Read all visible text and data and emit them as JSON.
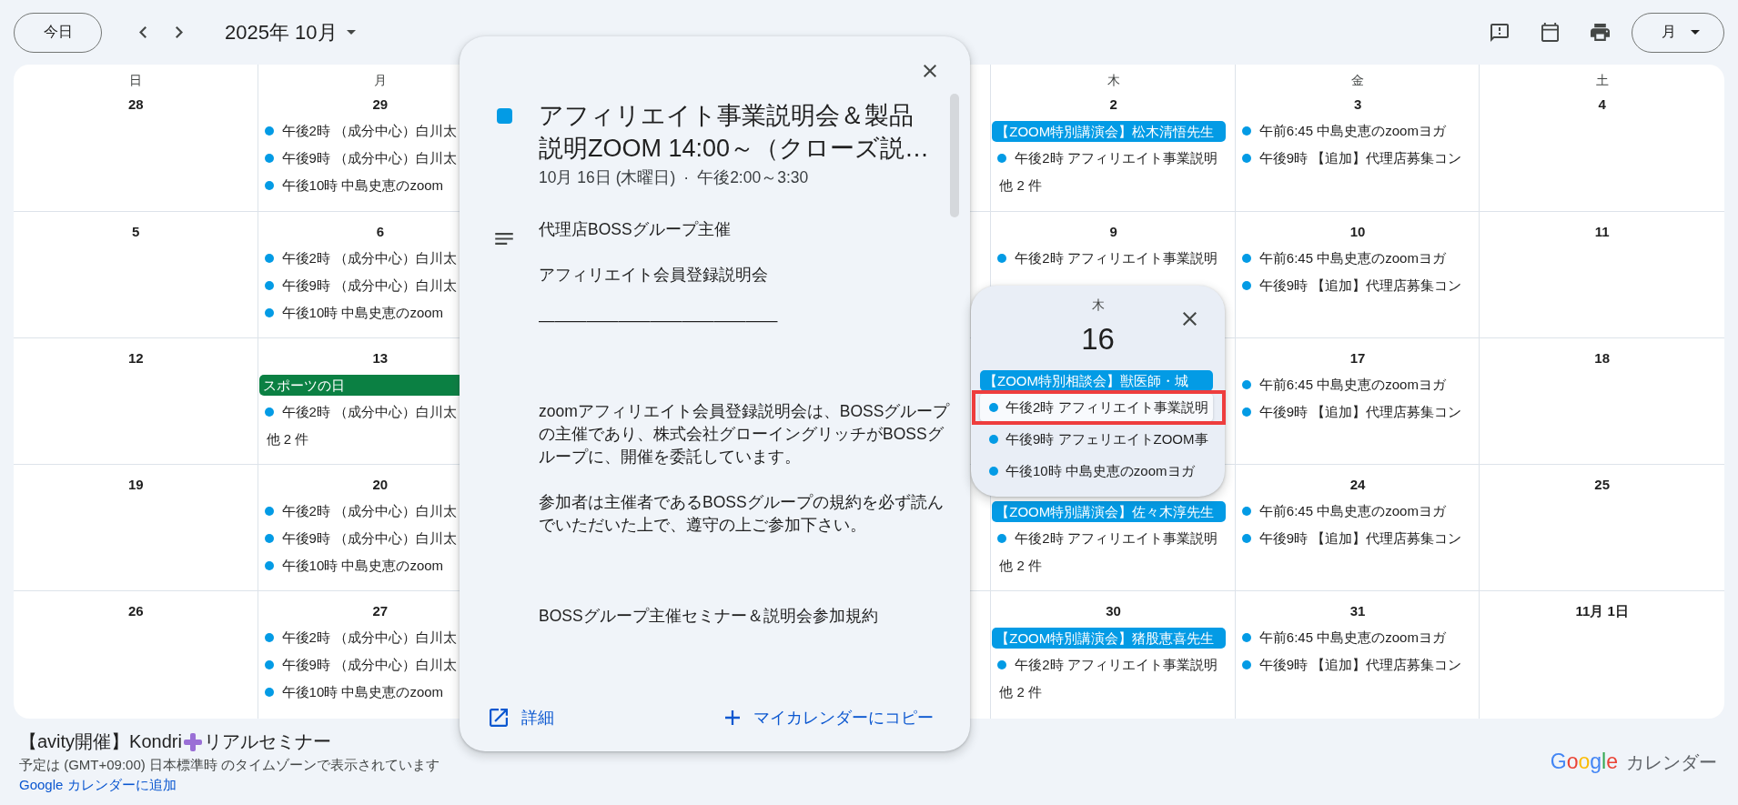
{
  "toolbar": {
    "today_button": "今日",
    "month_title": "2025年 10月",
    "view_button": "月"
  },
  "calendar": {
    "weeks": [
      {
        "days": [
          {
            "kind": "day",
            "weekday": "日",
            "date": "28"
          },
          {
            "kind": "day",
            "weekday": "月",
            "date": "29",
            "items": [
              {
                "kind": "event",
                "text": "午後2時 （成分中心）白川太"
              },
              {
                "kind": "event",
                "text": "午後9時 （成分中心）白川太"
              },
              {
                "kind": "event",
                "text": "午後10時 中島史恵のzoom"
              }
            ]
          },
          {
            "kind": "covered"
          },
          {
            "kind": "covered"
          },
          {
            "kind": "day",
            "weekday": "木",
            "date": "2",
            "items": [
              {
                "kind": "chip",
                "text": "【ZOOM特別講演会】松木清悟先生",
                "color": "#039be5"
              },
              {
                "kind": "event",
                "text": "午後2時 アフィリエイト事業説明"
              },
              {
                "kind": "more",
                "text": "他 2 件"
              }
            ]
          },
          {
            "kind": "day",
            "weekday": "金",
            "date": "3",
            "items": [
              {
                "kind": "event",
                "text": "午前6:45 中島史恵のzoomヨガ"
              },
              {
                "kind": "event",
                "text": "午後9時 【追加】代理店募集コン"
              }
            ]
          },
          {
            "kind": "day",
            "weekday": "土",
            "date": "4"
          }
        ]
      },
      {
        "days": [
          {
            "kind": "day",
            "date": "5"
          },
          {
            "kind": "day",
            "date": "6",
            "items": [
              {
                "kind": "event",
                "text": "午後2時 （成分中心）白川太"
              },
              {
                "kind": "event",
                "text": "午後9時 （成分中心）白川太"
              },
              {
                "kind": "event",
                "text": "午後10時 中島史恵のzoom"
              }
            ]
          },
          {
            "kind": "covered"
          },
          {
            "kind": "covered"
          },
          {
            "kind": "day",
            "date": "9",
            "items": [
              {
                "kind": "event",
                "text": "午後2時 アフィリエイト事業説明"
              }
            ]
          },
          {
            "kind": "day",
            "date": "10",
            "items": [
              {
                "kind": "event",
                "text": "午前6:45 中島史恵のzoomヨガ"
              },
              {
                "kind": "event",
                "text": "午後9時 【追加】代理店募集コン"
              }
            ]
          },
          {
            "kind": "day",
            "date": "11"
          }
        ]
      },
      {
        "days": [
          {
            "kind": "day",
            "date": "12"
          },
          {
            "kind": "day",
            "date": "13",
            "items": [
              {
                "kind": "chip",
                "text": "スポーツの日",
                "color": "#0b8043"
              },
              {
                "kind": "event",
                "text": "午後2時 （成分中心）白川太"
              },
              {
                "kind": "more",
                "text": "他 2 件"
              }
            ]
          },
          {
            "kind": "covered"
          },
          {
            "kind": "covered"
          },
          {
            "kind": "covered"
          },
          {
            "kind": "day",
            "date": "17",
            "items": [
              {
                "kind": "event",
                "text": "午前6:45 中島史恵のzoomヨガ"
              },
              {
                "kind": "event",
                "text": "午後9時 【追加】代理店募集コン"
              }
            ]
          },
          {
            "kind": "day",
            "date": "18"
          }
        ]
      },
      {
        "days": [
          {
            "kind": "day",
            "date": "19"
          },
          {
            "kind": "day",
            "date": "20",
            "items": [
              {
                "kind": "event",
                "text": "午後2時 （成分中心）白川太"
              },
              {
                "kind": "event",
                "text": "午後9時 （成分中心）白川太"
              },
              {
                "kind": "event",
                "text": "午後10時 中島史恵のzoom"
              }
            ]
          },
          {
            "kind": "covered"
          },
          {
            "kind": "covered"
          },
          {
            "kind": "day",
            "items": [
              {
                "kind": "chip",
                "text": "【ZOOM特別講演会】佐々木淳先生",
                "color": "#039be5"
              },
              {
                "kind": "event",
                "text": "午後2時 アフィリエイト事業説明"
              },
              {
                "kind": "more",
                "text": "他 2 件"
              }
            ]
          },
          {
            "kind": "day",
            "date": "24",
            "items": [
              {
                "kind": "event",
                "text": "午前6:45 中島史恵のzoomヨガ"
              },
              {
                "kind": "event",
                "text": "午後9時 【追加】代理店募集コン"
              }
            ]
          },
          {
            "kind": "day",
            "date": "25"
          }
        ]
      },
      {
        "days": [
          {
            "kind": "day",
            "date": "26"
          },
          {
            "kind": "day",
            "date": "27",
            "items": [
              {
                "kind": "event",
                "text": "午後2時 （成分中心）白川太"
              },
              {
                "kind": "event",
                "text": "午後9時 （成分中心）白川太"
              },
              {
                "kind": "event",
                "text": "午後10時 中島史恵のzoom"
              }
            ]
          },
          {
            "kind": "covered"
          },
          {
            "kind": "covered"
          },
          {
            "kind": "day",
            "date": "30",
            "items": [
              {
                "kind": "chip",
                "text": "【ZOOM特別講演会】猪股恵喜先生",
                "color": "#039be5"
              },
              {
                "kind": "event",
                "text": "午後2時 アフィリエイト事業説明"
              },
              {
                "kind": "more",
                "text": "他 2 件"
              }
            ]
          },
          {
            "kind": "day",
            "date": "31",
            "items": [
              {
                "kind": "event",
                "text": "午前6:45 中島史恵のzoomヨガ"
              },
              {
                "kind": "event",
                "text": "午後9時 【追加】代理店募集コン"
              }
            ]
          },
          {
            "kind": "day",
            "date": "11月 1日"
          }
        ]
      }
    ]
  },
  "event_popup": {
    "title": "アフィリエイト事業説明会＆製品説明ZOOM 14:00～（クローズ説…",
    "date": "10月 16日 (木曜日)",
    "separator": "·",
    "time": "午後2:00～3:30",
    "description": [
      "代理店BOSSグループ主催",
      "アフィリエイト会員登録説明会",
      "———————————————",
      "zoomアフィリエイト会員登録説明会は、BOSSグループの主催であり、株式会社グローイングリッチがBOSSグループに、開催を委託しています。",
      "参加者は主催者であるBOSSグループの規約を必ず読んでいただいた上で、遵守の上ご参加下さい。",
      "BOSSグループ主催セミナー＆説明会参加規約"
    ],
    "details_button": "詳細",
    "copy_button": "マイカレンダーにコピー"
  },
  "day_popup": {
    "weekday": "木",
    "date": "16",
    "items": [
      {
        "kind": "chip",
        "text": "【ZOOM特別相談会】獣医師・城",
        "color": "#039be5",
        "selected": false
      },
      {
        "kind": "event",
        "text": "午後2時 アフィリエイト事業説明",
        "selected": true,
        "highlighted": true
      },
      {
        "kind": "event",
        "text": "午後9時 アフェリエイトZOOM事",
        "selected": false,
        "highlighted": false
      },
      {
        "kind": "event",
        "text": "午後10時 中島史恵のzoomヨガ",
        "selected": false,
        "highlighted": false
      }
    ]
  },
  "footer": {
    "calendar_title": [
      {
        "kind": "text",
        "text": "【avity開催】Kondri"
      },
      {
        "kind": "emoji"
      },
      {
        "kind": "text",
        "text": "リアルセミナー"
      }
    ],
    "timezone_note": "予定は (GMT+09:00) 日本標準時 のタイムゾーンで表示されています",
    "add_link": "Google カレンダーに追加",
    "brand": {
      "logo": "Google",
      "product": "カレンダー"
    }
  }
}
